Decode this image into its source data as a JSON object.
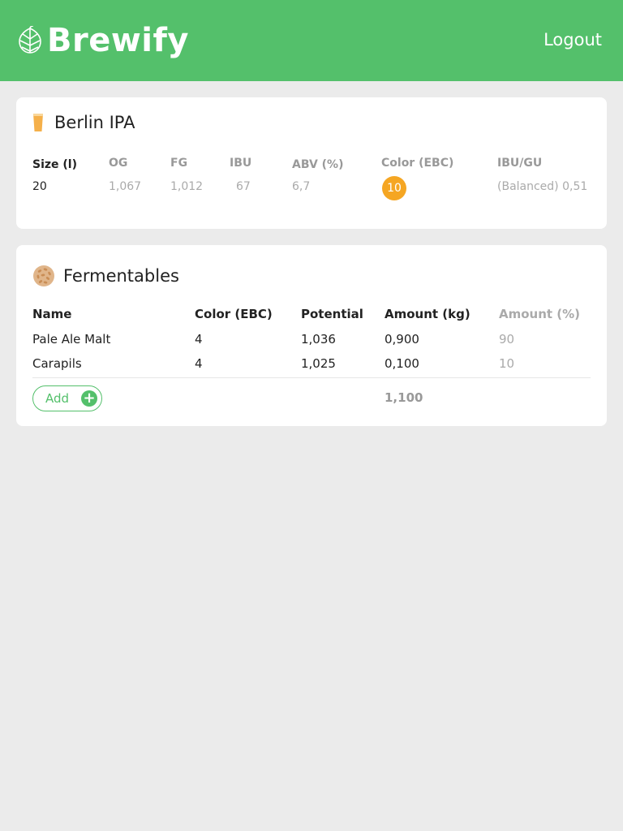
{
  "header": {
    "app_name": "Brewify",
    "logout_label": "Logout",
    "background_color": "#54c06b"
  },
  "recipe": {
    "title": "Berlin IPA",
    "icon": "beer-glass-icon",
    "stats": {
      "size_label": "Size (l)",
      "size_value": "20",
      "og_label": "OG",
      "og_value": "1,067",
      "fg_label": "FG",
      "fg_value": "1,012",
      "ibu_label": "IBU",
      "ibu_value": "67",
      "abv_label": "ABV (%)",
      "abv_value": "6,7",
      "color_label": "Color (EBC)",
      "color_value": "10",
      "color_swatch": "#f5a623",
      "ibugu_label": "IBU/GU",
      "ibugu_value": "(Balanced) 0,51"
    }
  },
  "fermentables": {
    "title": "Fermentables",
    "icon": "malt-grain-icon",
    "columns": [
      "Name",
      "Color (EBC)",
      "Potential",
      "Amount (kg)",
      "Amount (%)"
    ],
    "rows": [
      {
        "name": "Pale Ale Malt",
        "color": "4",
        "potential": "1,036",
        "amount_kg": "0,900",
        "amount_pct": "90"
      },
      {
        "name": "Carapils",
        "color": "4",
        "potential": "1,025",
        "amount_kg": "0,100",
        "amount_pct": "10"
      }
    ],
    "add_label": "Add",
    "total_kg": "1,100"
  }
}
